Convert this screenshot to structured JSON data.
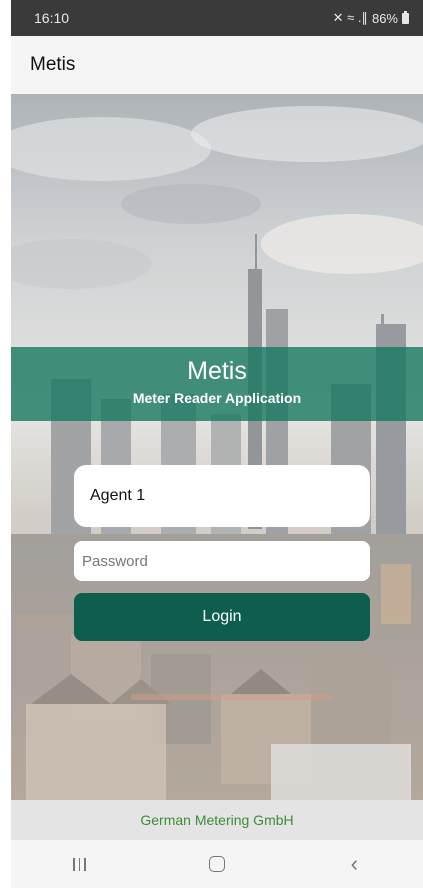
{
  "status_bar": {
    "time": "16:10",
    "signal_text": "✕ ≈ .∥",
    "battery": "86%"
  },
  "app_bar": {
    "title": "Metis"
  },
  "banner": {
    "title": "Metis",
    "subtitle": "Meter Reader Application"
  },
  "login_form": {
    "username_value": "Agent 1",
    "password_placeholder": "Password",
    "login_label": "Login"
  },
  "footer": {
    "company": "German Metering GmbH"
  },
  "icons": {
    "battery": "battery-icon",
    "recents": "recents-icon",
    "home": "home-icon",
    "back": "back-icon"
  },
  "colors": {
    "banner": "#187860",
    "login_button": "#0e5e4e",
    "footer_text": "#3f8b3a"
  }
}
